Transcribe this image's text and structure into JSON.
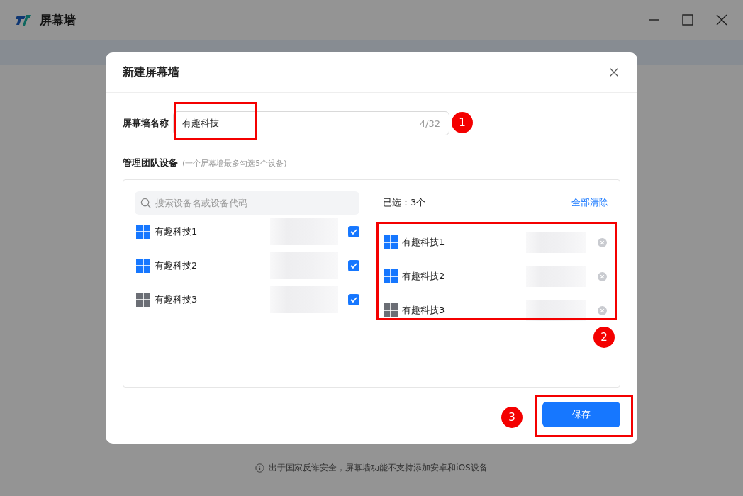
{
  "window": {
    "title": "屏幕墙"
  },
  "footer_note": "出于国家反诈安全，屏幕墙功能不支持添加安卓和iOS设备",
  "dialog": {
    "title": "新建屏幕墙",
    "name_field": {
      "label": "屏幕墙名称",
      "value": "有趣科技",
      "counter": "4/32"
    },
    "section": {
      "label": "管理团队设备",
      "hint": "(一个屏幕墙最多勾选5个设备)"
    },
    "search": {
      "placeholder": "搜索设备名或设备代码"
    },
    "devices": [
      {
        "name": "有趣科技1",
        "online": true,
        "checked": true
      },
      {
        "name": "有趣科技2",
        "online": true,
        "checked": true
      },
      {
        "name": "有趣科技3",
        "online": false,
        "checked": true
      }
    ],
    "selected_header": "已选：3个",
    "clear_all": "全部清除",
    "selected": [
      {
        "name": "有趣科技1",
        "online": true
      },
      {
        "name": "有趣科技2",
        "online": true
      },
      {
        "name": "有趣科技3",
        "online": false
      }
    ],
    "save_button": "保存"
  },
  "annotations": [
    {
      "number": "1"
    },
    {
      "number": "2"
    },
    {
      "number": "3"
    }
  ]
}
